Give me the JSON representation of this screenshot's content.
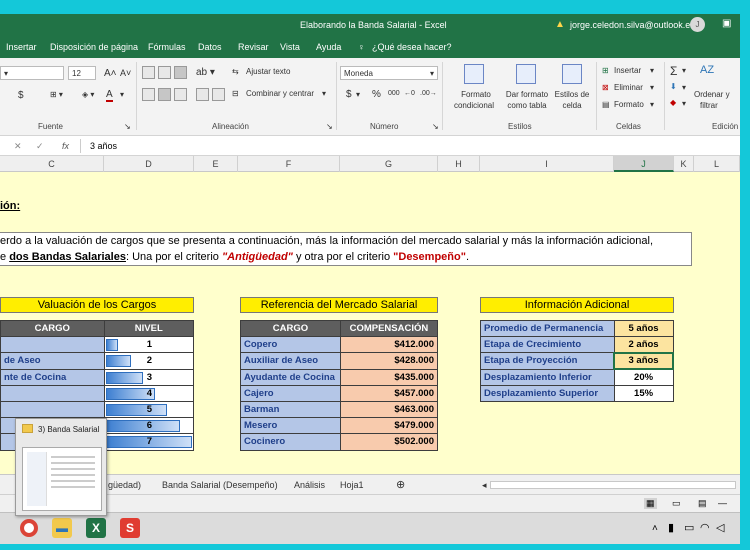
{
  "window": {
    "title": "Elaborando la Banda Salarial  -  Excel",
    "user": "jorge.celedon.silva@outlook.es",
    "avatar_letter": "J"
  },
  "menu": [
    "Insertar",
    "Disposición de página",
    "Fórmulas",
    "Datos",
    "Revisar",
    "Vista",
    "Ayuda",
    "¿Qué desea hacer?"
  ],
  "ribbon": {
    "font_size": "12",
    "wrap_text": "Ajustar texto",
    "merge_center": "Combinar y centrar",
    "number_format": "Moneda",
    "currency": "$",
    "percent": "%",
    "thousands": "000",
    "cond_format": [
      "Formato",
      "condicional"
    ],
    "table_format": [
      "Dar formato",
      "como tabla"
    ],
    "cell_styles": [
      "Estilos de",
      "celda"
    ],
    "insert": "Insertar",
    "delete": "Eliminar",
    "format": "Formato",
    "sort_filter": [
      "Ordenar y",
      "filtrar"
    ],
    "groups": [
      "Fuente",
      "Alineación",
      "Número",
      "Estilos",
      "Celdas",
      "Edición"
    ]
  },
  "formula_bar": {
    "fx": "fx",
    "value": "3 años"
  },
  "columns": [
    "C",
    "D",
    "E",
    "F",
    "G",
    "H",
    "I",
    "J",
    "K",
    "L"
  ],
  "selected_column": "J",
  "sheet": {
    "heading": "ión:",
    "note_line1": "erdo a la valuación de cargos que se presenta a continuación, más la información del mercado salarial y más la información adicional,",
    "note_line2_prefix": "e ",
    "note_bold": "dos Bandas Salariales",
    "note_mid": ": Una por el criterio ",
    "crit1": "\"Antigüedad\"",
    "note_mid2": " y otra por el criterio ",
    "crit2": "\"Desempeño\"",
    "note_end": "."
  },
  "valuacion": {
    "title": "Valuación de los Cargos",
    "headers": [
      "CARGO",
      "NIVEL"
    ],
    "rows": [
      {
        "cargo": "",
        "nivel": 1
      },
      {
        "cargo": "de Aseo",
        "nivel": 2
      },
      {
        "cargo": "nte de Cocina",
        "nivel": 3
      },
      {
        "cargo": "",
        "nivel": 4
      },
      {
        "cargo": "",
        "nivel": 5
      },
      {
        "cargo": "",
        "nivel": 6
      },
      {
        "cargo": "",
        "nivel": 7
      }
    ]
  },
  "mercado": {
    "title": "Referencia del Mercado Salarial",
    "headers": [
      "CARGO",
      "COMPENSACIÓN"
    ],
    "rows": [
      {
        "cargo": "Copero",
        "comp": "$412.000"
      },
      {
        "cargo": "Auxiliar de Aseo",
        "comp": "$428.000"
      },
      {
        "cargo": "Ayudante de Cocina",
        "comp": "$435.000"
      },
      {
        "cargo": "Cajero",
        "comp": "$457.000"
      },
      {
        "cargo": "Barman",
        "comp": "$463.000"
      },
      {
        "cargo": "Mesero",
        "comp": "$479.000"
      },
      {
        "cargo": "Cocinero",
        "comp": "$502.000"
      }
    ]
  },
  "adicional": {
    "title": "Información Adicional",
    "rows": [
      {
        "label": "Promedio de Permanencia",
        "value": "5 años"
      },
      {
        "label": "Etapa de Crecimiento",
        "value": "2 años"
      },
      {
        "label": "Etapa de Proyección",
        "value": "3 años"
      },
      {
        "label": "Desplazamiento Inferior",
        "value": "20%"
      },
      {
        "label": "Desplazamiento Superior",
        "value": "15%"
      }
    ]
  },
  "tabs": [
    "güedad)",
    "Banda Salarial (Desempeño)",
    "Análisis",
    "Hoja1"
  ],
  "popup": {
    "label": "3) Banda Salarial"
  }
}
